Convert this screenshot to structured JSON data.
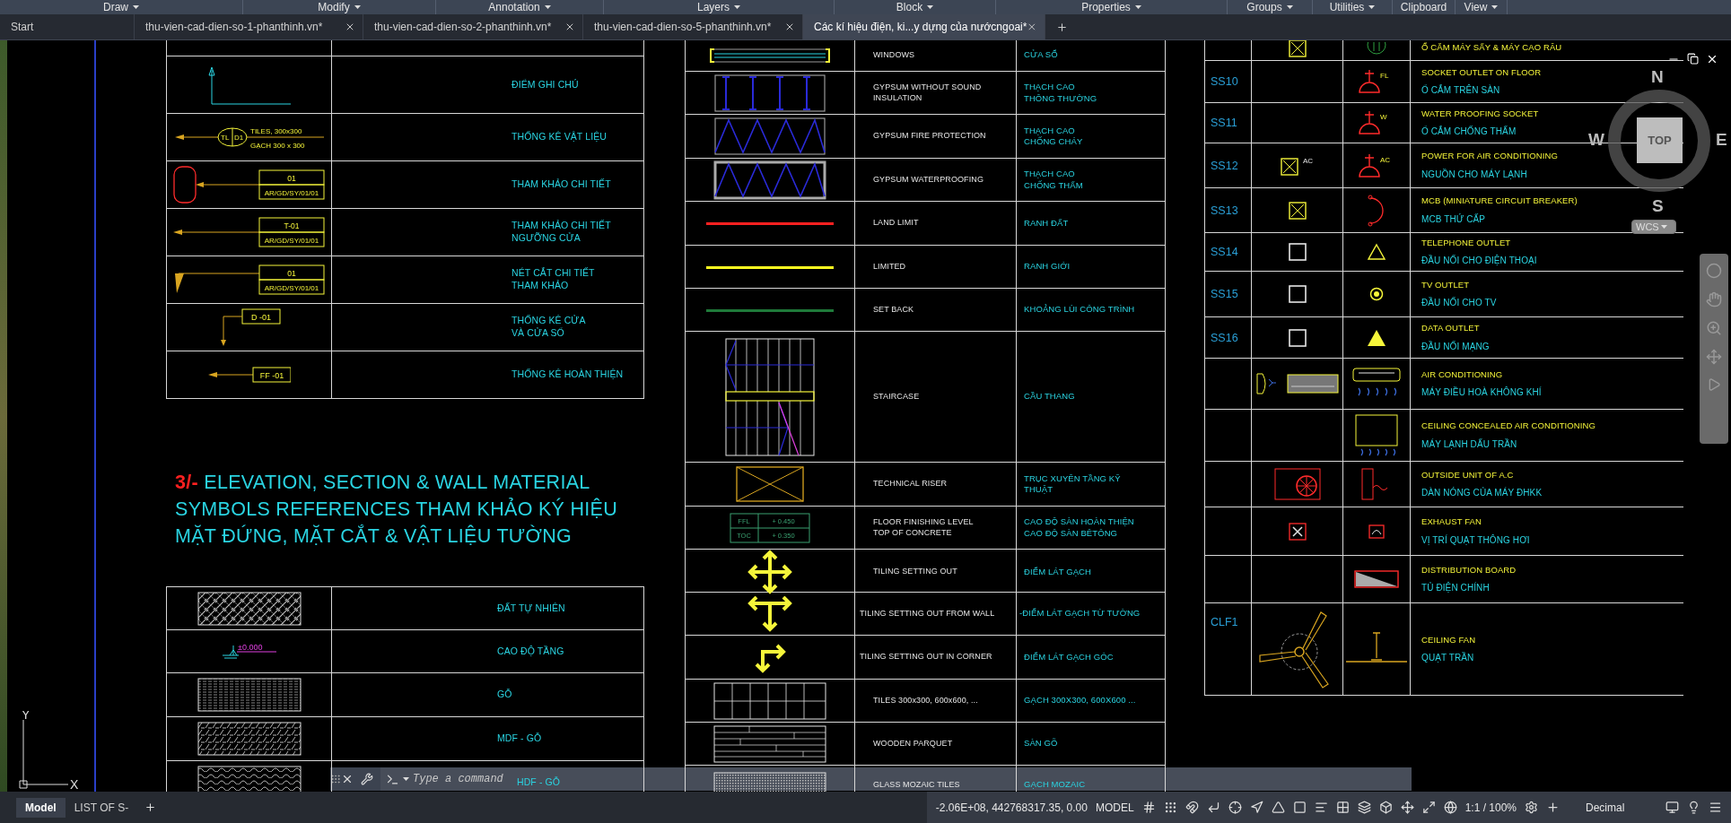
{
  "ribbon_panels": [
    {
      "label": "Draw",
      "menu": true
    },
    {
      "label": "Modify",
      "menu": true
    },
    {
      "label": "Annotation",
      "menu": true
    },
    {
      "label": "Layers",
      "menu": true
    },
    {
      "label": "Block",
      "menu": true
    },
    {
      "label": "Properties",
      "menu": true
    },
    {
      "label": "Groups",
      "menu": true
    },
    {
      "label": "Utilities",
      "menu": true
    },
    {
      "label": "Clipboard",
      "menu": false
    },
    {
      "label": "View",
      "menu": true
    }
  ],
  "file_tabs": [
    {
      "label": "Start",
      "selected": false,
      "closable": false
    },
    {
      "label": "thu-vien-cad-dien-so-1-phanthinh.vn*",
      "selected": false,
      "closable": true
    },
    {
      "label": "thu-vien-cad-dien-so-2-phanthinh.vn*",
      "selected": false,
      "closable": true
    },
    {
      "label": "thu-vien-cad-dien-so-5-phanthinh.vn*",
      "selected": false,
      "closable": true
    },
    {
      "label": "Các kí hiệu điện, ki...y dựng của nướcngoai*",
      "selected": true,
      "closable": true
    }
  ],
  "upper_table": {
    "rows": [
      {
        "symbol": {
          "kind": "note-point"
        },
        "lines": [
          "ĐIỂM GHI CHÚ"
        ]
      },
      {
        "symbol": {
          "kind": "material-tag",
          "tags": [
            "TL",
            "D1",
            "TILES, 300x300",
            "GẠCH 300 x 300"
          ]
        },
        "lines": [
          "THỐNG KÊ VẬT LIỆU"
        ]
      },
      {
        "symbol": {
          "kind": "detail-callout",
          "tags": [
            "01",
            "AR/GD/SY/01/01"
          ]
        },
        "lines": [
          "THAM KHẢO CHI TIẾT"
        ]
      },
      {
        "symbol": {
          "kind": "detail-tag",
          "tags": [
            "T-01",
            "AR/GD/SY/01/01"
          ]
        },
        "lines": [
          "THAM KHẢO CHI TIẾT",
          "NGƯỠNG CỬA"
        ]
      },
      {
        "symbol": {
          "kind": "section-tag",
          "tags": [
            "01",
            "AR/GD/SY/01/01"
          ]
        },
        "lines": [
          "NÉT CẮT  CHI TIẾT",
          "THAM KHẢO"
        ]
      },
      {
        "symbol": {
          "kind": "door-tag",
          "tags": [
            "D -01"
          ]
        },
        "lines": [
          "THỐNG KÊ CỬA",
          "VÀ CỬA SỔ"
        ]
      },
      {
        "symbol": {
          "kind": "finish-tag",
          "tags": [
            "FF -01"
          ]
        },
        "lines": [
          "THỐNG KÊ HOÀN THIỆN"
        ]
      }
    ]
  },
  "heading": {
    "number": "3/-",
    "lines": [
      "ELEVATION,  SECTION & WALL MATERIAL",
      "SYMBOLS REFERENCES THAM KHẢO KÝ HIỆU",
      "MẶT ĐỨNG, MẶT CẮT & VẬT LIỆU TƯỜNG"
    ]
  },
  "lower_table": {
    "rows": [
      {
        "symbol": {
          "kind": "hatch-basket"
        },
        "lines": [
          "ĐẤT TỰ NHIÊN"
        ]
      },
      {
        "symbol": {
          "kind": "level-mark",
          "tags": [
            "±0.000"
          ]
        },
        "lines": [
          "CAO ĐỘ TẦNG"
        ]
      },
      {
        "symbol": {
          "kind": "hatch-grain"
        },
        "lines": [
          "GỖ"
        ]
      },
      {
        "symbol": {
          "kind": "hatch-mdf"
        },
        "lines": [
          "MDF - GỖ"
        ]
      },
      {
        "symbol": {
          "kind": "hatch-hdf"
        },
        "lines": [
          "HDF - GỖ"
        ]
      }
    ]
  },
  "middle_table": {
    "rows": [
      {
        "symbol": {
          "kind": "window"
        },
        "english": [
          "WINDOWS"
        ],
        "vietnamese": [
          "CỬA SỔ"
        ]
      },
      {
        "symbol": {
          "kind": "gypsum-plain"
        },
        "english": [
          "GYPSUM WITHOUT SOUND",
          "INSULATION"
        ],
        "vietnamese": [
          "THẠCH CAO",
          "THÔNG THƯỜNG"
        ]
      },
      {
        "symbol": {
          "kind": "gypsum-fire"
        },
        "english": [
          "GYPSUM FIRE PROTECTION"
        ],
        "vietnamese": [
          "THẠCH CAO",
          "CHỐNG CHÁY"
        ]
      },
      {
        "symbol": {
          "kind": "gypsum-water"
        },
        "english": [
          "GYPSUM WATERPROOFING"
        ],
        "vietnamese": [
          "THẠCH CAO",
          "CHỐNG THẤM"
        ]
      },
      {
        "symbol": {
          "kind": "line",
          "color": "#ff2020"
        },
        "english": [
          "LAND LIMIT"
        ],
        "vietnamese": [
          "RANH ĐẤT"
        ]
      },
      {
        "symbol": {
          "kind": "line",
          "color": "#ffff20"
        },
        "english": [
          "LIMITED"
        ],
        "vietnamese": [
          "RANH GIỚI"
        ]
      },
      {
        "symbol": {
          "kind": "line",
          "color": "#1f7a3a"
        },
        "english": [
          "SET BACK"
        ],
        "vietnamese": [
          "KHOẢNG LÙI CÔNG TRÌNH"
        ]
      },
      {
        "symbol": {
          "kind": "staircase"
        },
        "english": [
          "STAIRCASE"
        ],
        "vietnamese": [
          "CẦU THANG"
        ]
      },
      {
        "symbol": {
          "kind": "riser"
        },
        "english": [
          "TECHNICAL RISER"
        ],
        "vietnamese": [
          "TRỤC XUYÊN TẦNG KỸ",
          "THUẬT"
        ]
      },
      {
        "symbol": {
          "kind": "level-table",
          "tags": [
            "FFL",
            "+ 0.450",
            "TOC",
            "+ 0.350"
          ]
        },
        "english": [
          "FLOOR FINISHING LEVEL",
          "TOP OF CONCRETE"
        ],
        "vietnamese": [
          "CAO ĐỘ SÀN HOÀN THIỆN",
          "CAO ĐỘ SÀN BÊTÔNG"
        ]
      },
      {
        "symbol": {
          "kind": "arrows-four"
        },
        "english": [
          "TILING SETTING OUT"
        ],
        "vietnamese": [
          "ĐIỂM LÁT GẠCH"
        ]
      },
      {
        "symbol": {
          "kind": "arrows-three"
        },
        "english": [
          "TILING SETTING OUT FROM WALL"
        ],
        "vietnamese": [
          "-ĐIỂM LÁT GẠCH TỪ TƯỜNG"
        ]
      },
      {
        "symbol": {
          "kind": "arrows-corner"
        },
        "english": [
          "TILING SETTING OUT IN CORNER"
        ],
        "vietnamese": [
          "ĐIỂM LÁT GẠCH GÓC"
        ]
      },
      {
        "symbol": {
          "kind": "tile-grid"
        },
        "english": [
          "TILES 300x300,  600x600,  ..."
        ],
        "vietnamese": [
          "GẠCH 300X300, 600X600 ..."
        ]
      },
      {
        "symbol": {
          "kind": "parquet"
        },
        "english": [
          "WOODEN PARQUET"
        ],
        "vietnamese": [
          "SÀN GỖ"
        ]
      },
      {
        "symbol": {
          "kind": "mosaic"
        },
        "english": [
          "GLASS MOZAIC TILES"
        ],
        "vietnamese": [
          "GẠCH MOZAIC"
        ]
      }
    ]
  },
  "right_table": {
    "rows": [
      {
        "symbol_1": {
          "kind": "box-cross"
        },
        "symbol_2": {
          "kind": "shaver-outlet"
        },
        "english": "Ổ CẮM MÁY SẤY & MÁY CẠO RÂU"
      },
      {
        "code": "SS10",
        "symbol_2": {
          "kind": "socket",
          "tags": [
            "FL"
          ]
        },
        "english": "SOCKET OUTLET ON FLOOR",
        "vietnamese": "Ổ CẮM TRÊN SÀN"
      },
      {
        "code": "SS11",
        "symbol_2": {
          "kind": "socket",
          "tags": [
            "W"
          ]
        },
        "english": "WATER PROOFING  SOCKET",
        "vietnamese": "Ổ CẮM CHỐNG THẤM"
      },
      {
        "code": "SS12",
        "symbol_1": {
          "kind": "box-cross",
          "tags": [
            "AC"
          ]
        },
        "symbol_2": {
          "kind": "socket",
          "tags": [
            "AC"
          ]
        },
        "english": "POWER FOR AIR CONDITIONING",
        "vietnamese": "NGUỒN CHO MÁY LẠNH"
      },
      {
        "code": "SS13",
        "symbol_1": {
          "kind": "box-cross"
        },
        "symbol_2": {
          "kind": "breaker"
        },
        "english": "MCB (MINIATURE CIRCUIT BREAKER)",
        "vietnamese": "MCB THỨ CẤP"
      },
      {
        "code": "SS14",
        "symbol_1": {
          "kind": "square"
        },
        "symbol_2": {
          "kind": "triangle-outline"
        },
        "english": "TELEPHONE OUTLET",
        "vietnamese": "ĐẦU NỐI CHO ĐIỆN THOẠI"
      },
      {
        "code": "SS15",
        "symbol_1": {
          "kind": "square"
        },
        "symbol_2": {
          "kind": "target"
        },
        "english": "TV OUTLET",
        "vietnamese": "ĐẦU NỐI CHO TV"
      },
      {
        "code": "SS16",
        "symbol_1": {
          "kind": "square"
        },
        "symbol_2": {
          "kind": "triangle-filled"
        },
        "english": "DATA OUTLET",
        "vietnamese": "ĐẦU NỐI MẠNG"
      },
      {
        "symbol_1": {
          "kind": "ac-wall"
        },
        "symbol_2": {
          "kind": "ac-unit"
        },
        "english": "AIR CONDITIONING",
        "vietnamese": "MÁY ĐIỀU HOÀ KHÔNG KHÍ"
      },
      {
        "symbol_2": {
          "kind": "ceiling-ac"
        },
        "english": "CEILING CONCEALED AIR CONDITIONING",
        "vietnamese": "MÁY LẠNH DẤU TRẦN"
      },
      {
        "symbol_1": {
          "kind": "outdoor-unit"
        },
        "symbol_2": {
          "kind": "outdoor-side"
        },
        "english": "OUTSIDE UNIT OF A.C",
        "vietnamese": "DÀN NÓNG CỦA MÁY ĐHKK"
      },
      {
        "symbol_1": {
          "kind": "exhaust-fan"
        },
        "symbol_2": {
          "kind": "exhaust-side"
        },
        "english": "EXHAUST FAN",
        "vietnamese": "VỊ TRÍ QUẠT THÔNG HƠI"
      },
      {
        "symbol_2": {
          "kind": "distribution-board"
        },
        "english": "DISTRIBUTION BOARD",
        "vietnamese": "TỦ ĐIỆN CHÍNH"
      },
      {
        "code": "CLF1",
        "symbol_1": {
          "kind": "ceiling-fan"
        },
        "symbol_2": {
          "kind": "fan-side"
        },
        "english": "CEILING FAN",
        "vietnamese": "QUẠT TRẦN"
      }
    ]
  },
  "view_cube": {
    "north": "N",
    "south": "S",
    "east": "E",
    "west": "W",
    "face": "TOP",
    "coordinate_system": "WCS"
  },
  "ucs": {
    "y": "Y",
    "x": "X"
  },
  "command_line": {
    "placeholder": "Type a command"
  },
  "status_bar": {
    "layout_tabs": [
      {
        "label": "Model",
        "selected": true
      },
      {
        "label": "LIST OF S-",
        "selected": false
      }
    ],
    "coordinates": "-2.06E+08, 442768317.35, 0.00",
    "space": "MODEL",
    "scale": "1:1 / 100%",
    "units": "Decimal"
  }
}
